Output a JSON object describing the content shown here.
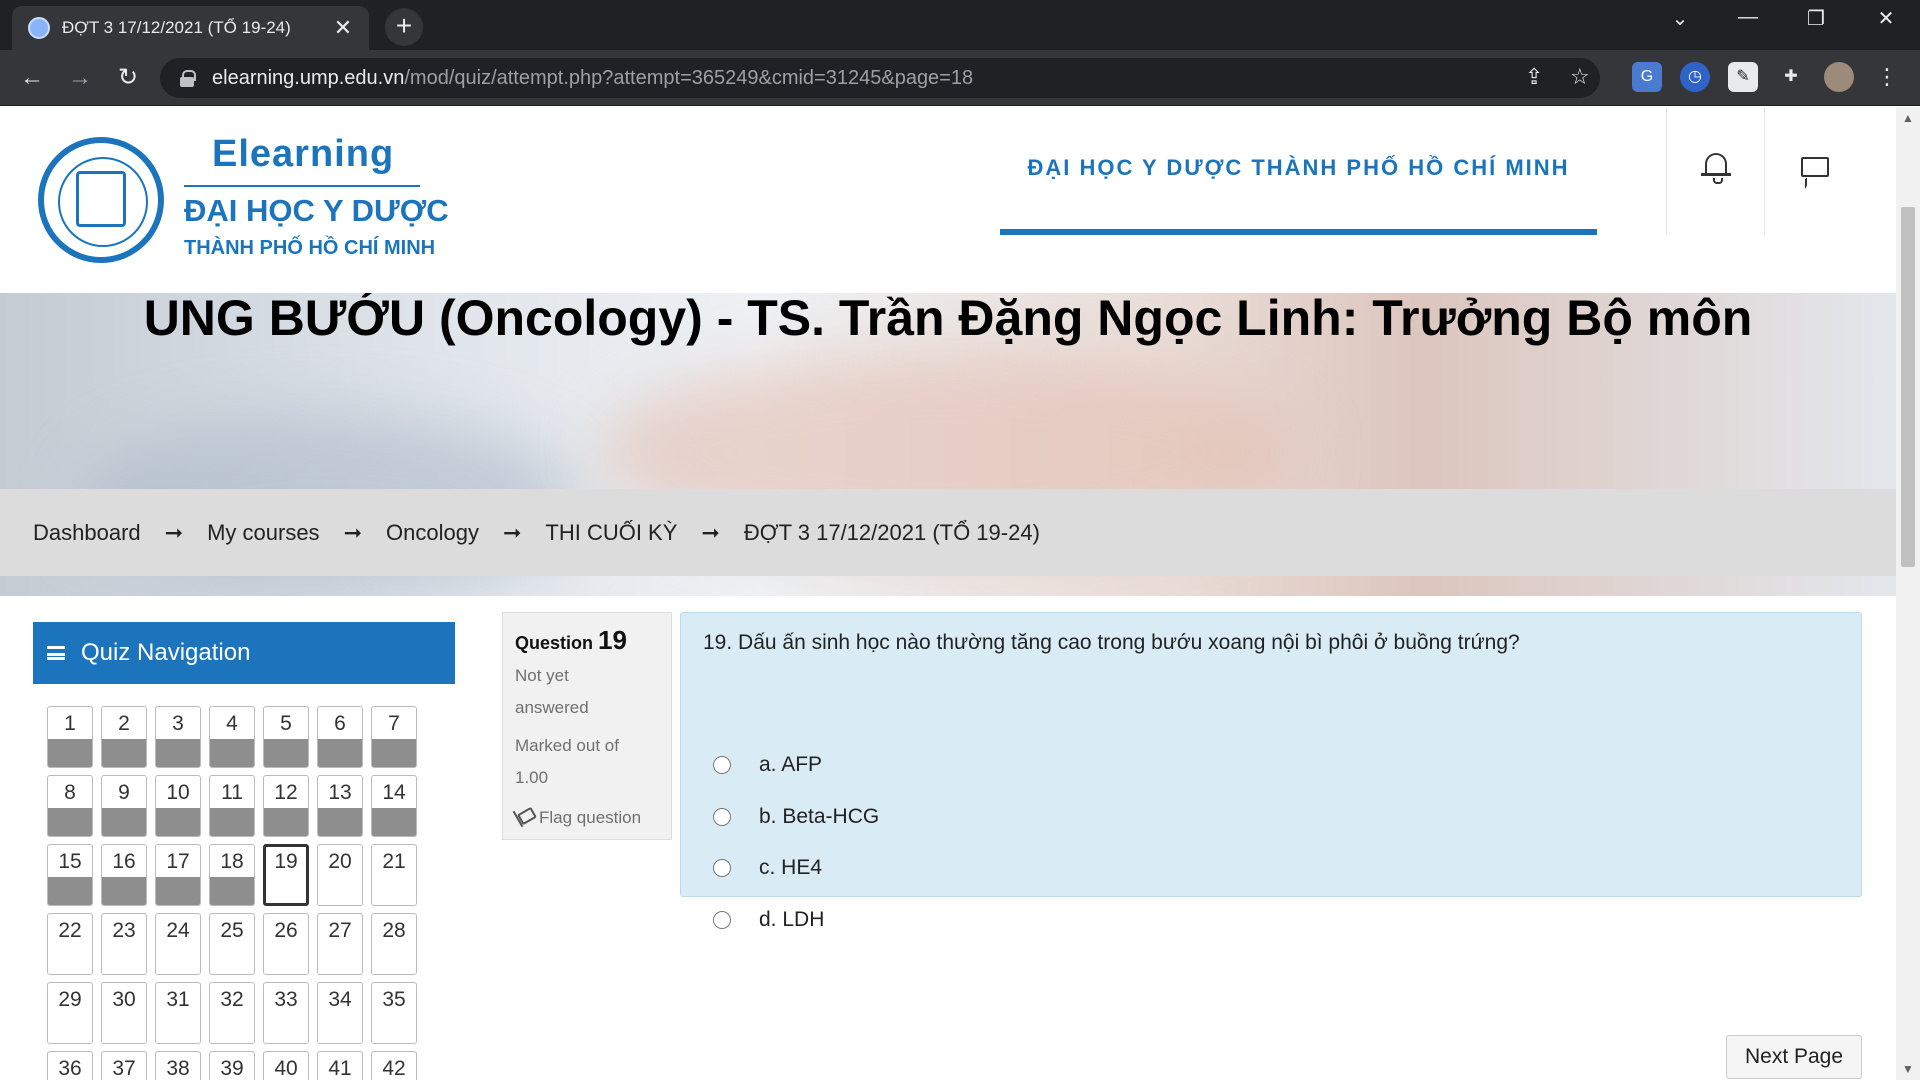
{
  "browser": {
    "tab_title": "ĐỢT 3 17/12/2021 (TỔ 19-24)",
    "url_host": "elearning.ump.edu.vn",
    "url_path": "/mod/quiz/attempt.php?attempt=365249&cmid=31245&page=18"
  },
  "header": {
    "logo_title": "Elearning",
    "logo_line2": "ĐẠI HỌC Y DƯỢC",
    "logo_line3": "THÀNH PHỐ HỒ CHÍ MINH",
    "university_link": "ĐẠI HỌC Y DƯỢC THÀNH PHỐ HỒ CHÍ MINH"
  },
  "banner": {
    "course_title": "UNG BƯỚU (Oncology) - TS. Trần Đặng Ngọc Linh: Trưởng Bộ môn"
  },
  "breadcrumb": {
    "items": [
      "Dashboard",
      "My courses",
      "Oncology",
      "THI CUỐI KỲ",
      "ĐỢT 3 17/12/2021 (TỔ 19-24)"
    ]
  },
  "quiz_nav": {
    "title": "Quiz Navigation",
    "current": 19,
    "answered_up_to": 18,
    "visible_count": 42
  },
  "question": {
    "label": "Question",
    "number": "19",
    "status": "Not yet answered",
    "status_line1": "Not yet",
    "status_line2": "answered",
    "marks_line1": "Marked out of",
    "marks_line2": "1.00",
    "flag_label": "Flag question",
    "text": "19. Dấu ấn sinh học nào thường tăng cao trong bướu xoang nội bì phôi ở buồng trứng?",
    "options": [
      "a. AFP",
      "b. Beta-HCG",
      "c. HE4",
      "d. LDH"
    ]
  },
  "footer": {
    "next_label": "Next Page"
  },
  "colors": {
    "brand_blue": "#1c75bc",
    "question_bg": "#d9ecf6",
    "answered_fill": "#8e8e8e"
  }
}
